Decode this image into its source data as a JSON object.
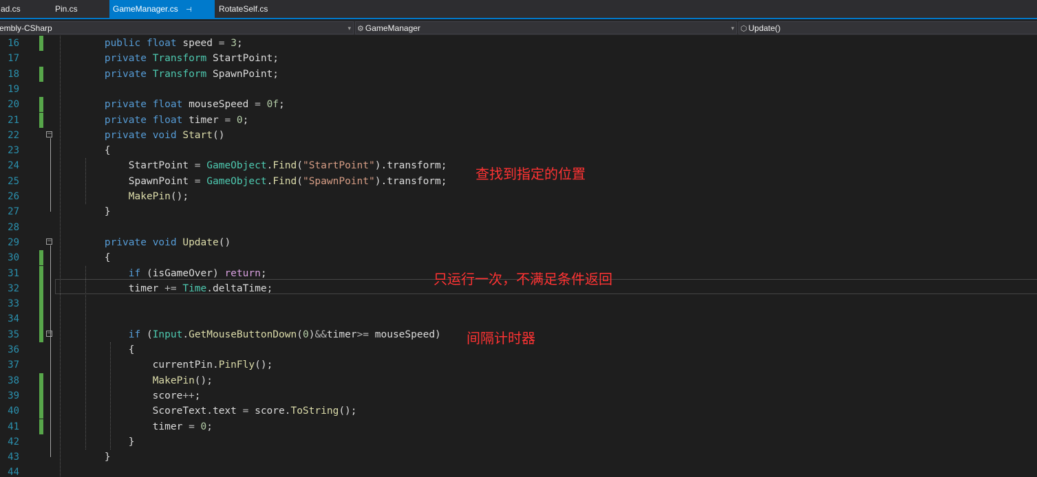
{
  "tabs": [
    {
      "label": "ad.cs"
    },
    {
      "label": "Pin.cs"
    },
    {
      "label": "GameManager.cs",
      "active": true,
      "pin_glyph": "⊣"
    },
    {
      "label": "RotateSelf.cs"
    }
  ],
  "navbar": {
    "project": "embly-CSharp",
    "class_name": "GameManager",
    "member": "Update()",
    "dropdown_glyph": "▾",
    "class_icon_glyph": "⚙",
    "member_icon_glyph": "⬡"
  },
  "colors": {
    "accent": "#007acc",
    "annotation": "#ff3333",
    "change_bar": "#57a64a",
    "line_number": "#2b91af"
  },
  "lines": [
    {
      "n": "16",
      "tokens": [
        [
          "pd",
          "    "
        ],
        [
          "kw",
          "public"
        ],
        [
          "pd",
          " "
        ],
        [
          "kw",
          "float"
        ],
        [
          "pd",
          " speed "
        ],
        [
          "op",
          "="
        ],
        [
          "pd",
          " "
        ],
        [
          "nu",
          "3"
        ],
        [
          "pd",
          ";"
        ]
      ]
    },
    {
      "n": "17",
      "tokens": [
        [
          "pd",
          "    "
        ],
        [
          "kw",
          "private"
        ],
        [
          "pd",
          " "
        ],
        [
          "ty",
          "Transform"
        ],
        [
          "pd",
          " StartPoint;"
        ]
      ]
    },
    {
      "n": "18",
      "tokens": [
        [
          "pd",
          "    "
        ],
        [
          "kw",
          "private"
        ],
        [
          "pd",
          " "
        ],
        [
          "ty",
          "Transform"
        ],
        [
          "pd",
          " SpawnPoint;"
        ]
      ]
    },
    {
      "n": "19",
      "tokens": []
    },
    {
      "n": "20",
      "tokens": [
        [
          "pd",
          "    "
        ],
        [
          "kw",
          "private"
        ],
        [
          "pd",
          " "
        ],
        [
          "kw",
          "float"
        ],
        [
          "pd",
          " mouseSpeed "
        ],
        [
          "op",
          "="
        ],
        [
          "pd",
          " "
        ],
        [
          "nu",
          "0f"
        ],
        [
          "pd",
          ";"
        ]
      ]
    },
    {
      "n": "21",
      "tokens": [
        [
          "pd",
          "    "
        ],
        [
          "kw",
          "private"
        ],
        [
          "pd",
          " "
        ],
        [
          "kw",
          "float"
        ],
        [
          "pd",
          " timer "
        ],
        [
          "op",
          "="
        ],
        [
          "pd",
          " "
        ],
        [
          "nu",
          "0"
        ],
        [
          "pd",
          ";"
        ]
      ]
    },
    {
      "n": "22",
      "tokens": [
        [
          "pd",
          "    "
        ],
        [
          "kw",
          "private"
        ],
        [
          "pd",
          " "
        ],
        [
          "kw",
          "void"
        ],
        [
          "pd",
          " "
        ],
        [
          "mt",
          "Start"
        ],
        [
          "pd",
          "()"
        ]
      ]
    },
    {
      "n": "23",
      "tokens": [
        [
          "pd",
          "    {"
        ]
      ]
    },
    {
      "n": "24",
      "tokens": [
        [
          "pd",
          "        StartPoint "
        ],
        [
          "op",
          "="
        ],
        [
          "pd",
          " "
        ],
        [
          "ty",
          "GameObject"
        ],
        [
          "pd",
          "."
        ],
        [
          "mt",
          "Find"
        ],
        [
          "pd",
          "("
        ],
        [
          "st",
          "\"StartPoint\""
        ],
        [
          "pd",
          ").transform;"
        ]
      ]
    },
    {
      "n": "25",
      "tokens": [
        [
          "pd",
          "        SpawnPoint "
        ],
        [
          "op",
          "="
        ],
        [
          "pd",
          " "
        ],
        [
          "ty",
          "GameObject"
        ],
        [
          "pd",
          "."
        ],
        [
          "mt",
          "Find"
        ],
        [
          "pd",
          "("
        ],
        [
          "st",
          "\"SpawnPoint\""
        ],
        [
          "pd",
          ").transform;"
        ]
      ]
    },
    {
      "n": "26",
      "tokens": [
        [
          "pd",
          "        "
        ],
        [
          "mt",
          "MakePin"
        ],
        [
          "pd",
          "();"
        ]
      ]
    },
    {
      "n": "27",
      "tokens": [
        [
          "pd",
          "    }"
        ]
      ]
    },
    {
      "n": "28",
      "tokens": []
    },
    {
      "n": "29",
      "tokens": [
        [
          "pd",
          "    "
        ],
        [
          "kw",
          "private"
        ],
        [
          "pd",
          " "
        ],
        [
          "kw",
          "void"
        ],
        [
          "pd",
          " "
        ],
        [
          "mt",
          "Update"
        ],
        [
          "pd",
          "()"
        ]
      ]
    },
    {
      "n": "30",
      "tokens": [
        [
          "pd",
          "    {"
        ]
      ]
    },
    {
      "n": "31",
      "tokens": [
        [
          "pd",
          "        "
        ],
        [
          "kw",
          "if"
        ],
        [
          "pd",
          " (isGameOver) "
        ],
        [
          "ctl",
          "return"
        ],
        [
          "pd",
          ";"
        ]
      ]
    },
    {
      "n": "32",
      "tokens": [
        [
          "pd",
          "        timer "
        ],
        [
          "op",
          "+="
        ],
        [
          "pd",
          " "
        ],
        [
          "ty",
          "Time"
        ],
        [
          "pd",
          ".deltaTime;"
        ]
      ]
    },
    {
      "n": "33",
      "tokens": []
    },
    {
      "n": "34",
      "tokens": []
    },
    {
      "n": "35",
      "tokens": [
        [
          "pd",
          "        "
        ],
        [
          "kw",
          "if"
        ],
        [
          "pd",
          " ("
        ],
        [
          "ty",
          "Input"
        ],
        [
          "pd",
          "."
        ],
        [
          "mt",
          "GetMouseButtonDown"
        ],
        [
          "pd",
          "("
        ],
        [
          "nu",
          "0"
        ],
        [
          "pd",
          ")"
        ],
        [
          "op",
          "&&"
        ],
        [
          "pd",
          "timer"
        ],
        [
          "op",
          ">="
        ],
        [
          "pd",
          " mouseSpeed)"
        ]
      ]
    },
    {
      "n": "36",
      "tokens": [
        [
          "pd",
          "        {"
        ]
      ]
    },
    {
      "n": "37",
      "tokens": [
        [
          "pd",
          "            currentPin."
        ],
        [
          "mt",
          "PinFly"
        ],
        [
          "pd",
          "();"
        ]
      ]
    },
    {
      "n": "38",
      "tokens": [
        [
          "pd",
          "            "
        ],
        [
          "mt",
          "MakePin"
        ],
        [
          "pd",
          "();"
        ]
      ]
    },
    {
      "n": "39",
      "tokens": [
        [
          "pd",
          "            score"
        ],
        [
          "op",
          "++"
        ],
        [
          "pd",
          ";"
        ]
      ]
    },
    {
      "n": "40",
      "tokens": [
        [
          "pd",
          "            ScoreText.text "
        ],
        [
          "op",
          "="
        ],
        [
          "pd",
          " score."
        ],
        [
          "mt",
          "ToString"
        ],
        [
          "pd",
          "();"
        ]
      ]
    },
    {
      "n": "41",
      "tokens": [
        [
          "pd",
          "            timer "
        ],
        [
          "op",
          "="
        ],
        [
          "pd",
          " "
        ],
        [
          "nu",
          "0"
        ],
        [
          "pd",
          ";"
        ]
      ]
    },
    {
      "n": "42",
      "tokens": [
        [
          "pd",
          "        }"
        ]
      ]
    },
    {
      "n": "43",
      "tokens": [
        [
          "pd",
          "    }"
        ]
      ]
    },
    {
      "n": "44",
      "tokens": []
    }
  ],
  "changed_lines": [
    "16",
    "18",
    "20",
    "21",
    "30",
    "31",
    "32",
    "33",
    "34",
    "35",
    "38",
    "39",
    "40",
    "41"
  ],
  "fold_lines": [
    "22",
    "29",
    "35"
  ],
  "annotations": [
    {
      "text": "查找到指定的位置"
    },
    {
      "text": "只运行一次，不满足条件返回"
    },
    {
      "text": "间隔计时器"
    }
  ]
}
